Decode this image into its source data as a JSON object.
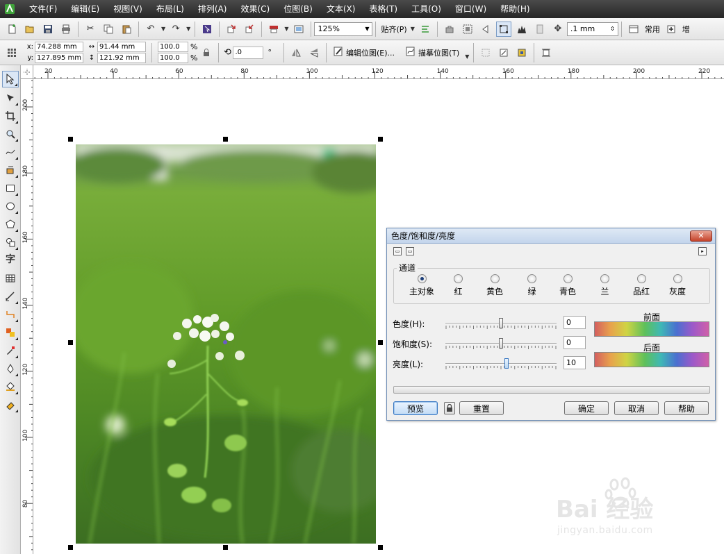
{
  "menu": [
    "文件(F)",
    "编辑(E)",
    "视图(V)",
    "布局(L)",
    "排列(A)",
    "效果(C)",
    "位图(B)",
    "文本(X)",
    "表格(T)",
    "工具(O)",
    "窗口(W)",
    "帮助(H)"
  ],
  "toolbar1": {
    "zoom": "125%",
    "snap_label": "贴齐(P)",
    "nudge": ".1 mm",
    "workspace_label": "常用",
    "more_label": "增"
  },
  "property_bar": {
    "x_label": "x:",
    "x_value": "74.288 mm",
    "y_label": "y:",
    "y_value": "127.895 mm",
    "width_value": "91.44 mm",
    "height_value": "121.92 mm",
    "scale_x": "100.0",
    "scale_y": "100.0",
    "pct": "%",
    "angle_value": ".0",
    "degree": "°",
    "edit_bitmap": "编辑位图(E)...",
    "trace_bitmap": "描摹位图(T)"
  },
  "ruler": {
    "top": [
      "20",
      "40",
      "60",
      "80",
      "100",
      "120",
      "140",
      "160",
      "180",
      "200",
      "220"
    ],
    "left": [
      "200",
      "180",
      "160",
      "140",
      "120",
      "100",
      "80"
    ]
  },
  "dialog": {
    "title": "色度/饱和度/亮度",
    "close": "✕",
    "channel_group": "通道",
    "channels": [
      "主对象",
      "红",
      "黄色",
      "绿",
      "青色",
      "兰",
      "品红",
      "灰度"
    ],
    "selected_channel": "主对象",
    "sliders": [
      {
        "label": "色度(H):",
        "value": "0",
        "fraction": 0.5
      },
      {
        "label": "饱和度(S):",
        "value": "0",
        "fraction": 0.5
      },
      {
        "label": "亮度(L):",
        "value": "10",
        "fraction": 0.55
      }
    ],
    "before_label": "前面",
    "after_label": "后面",
    "buttons": {
      "preview": "预览",
      "reset": "重置",
      "ok": "确定",
      "cancel": "取消",
      "help": "帮助"
    }
  },
  "watermark": {
    "text": "Bai 经验",
    "url": "jingyan.baidu.com"
  }
}
